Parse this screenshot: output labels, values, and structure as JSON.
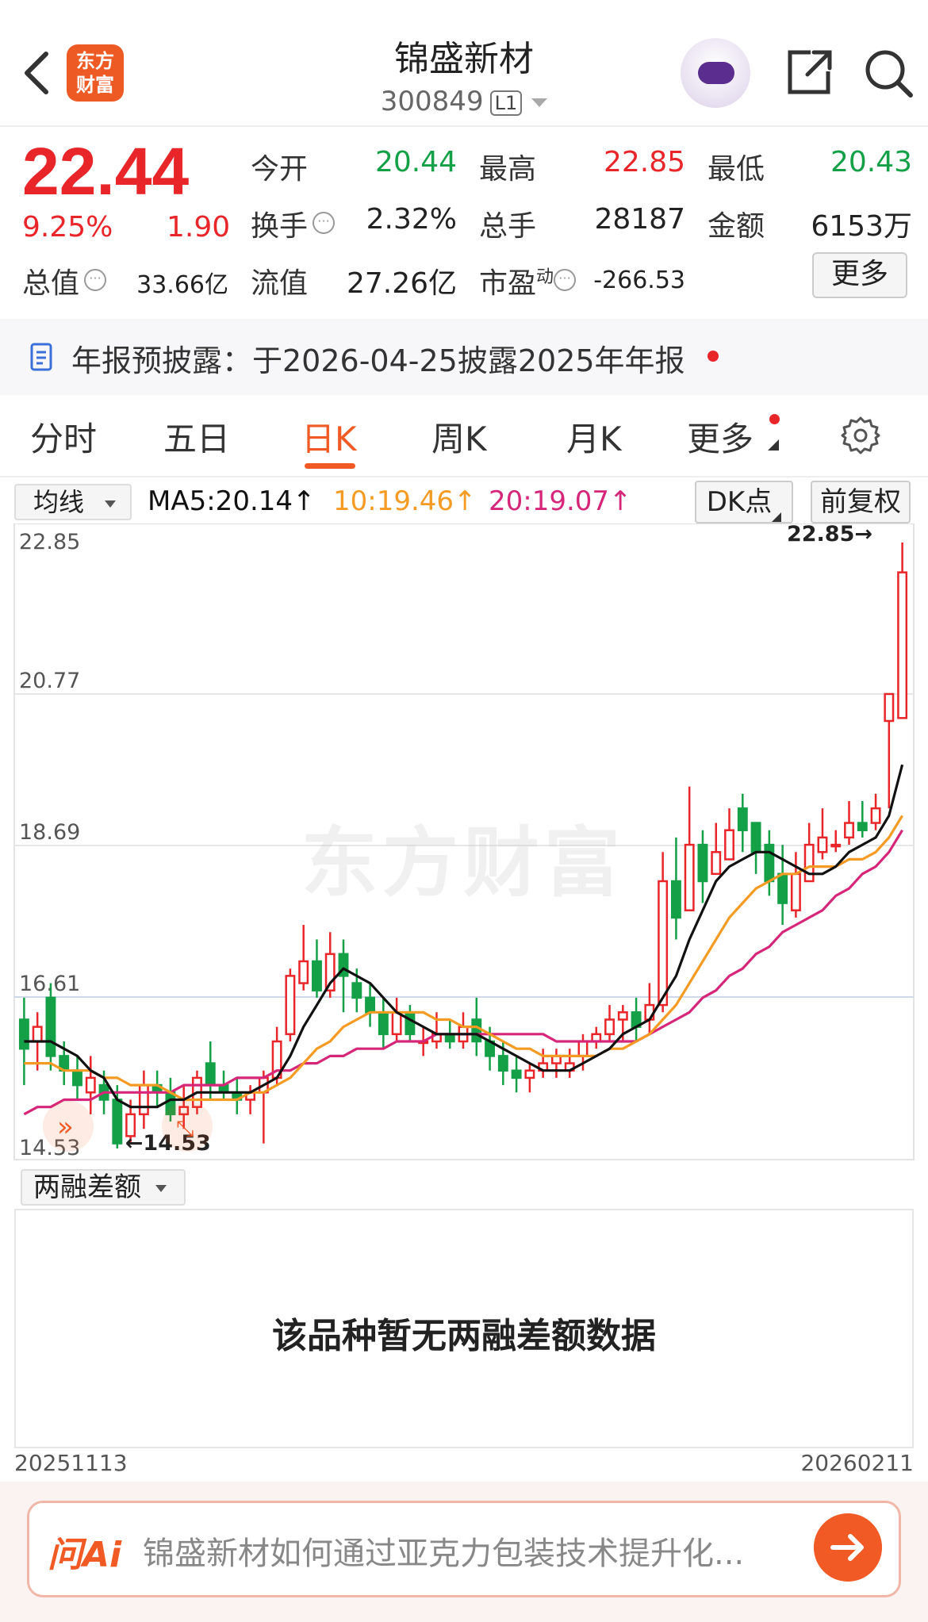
{
  "header": {
    "logo_line1": "东方",
    "logo_line2": "财富",
    "title": "锦盛新材",
    "code": "300849",
    "level_badge": "L1"
  },
  "quote": {
    "price": "22.44",
    "change_pct": "9.25%",
    "change": "1.90",
    "open_label": "今开",
    "open_value": "20.44",
    "high_label": "最高",
    "high_value": "22.85",
    "low_label": "最低",
    "low_value": "20.43",
    "turnover_label": "换手",
    "turnover_value": "2.32%",
    "volume_label": "总手",
    "volume_value": "28187",
    "amount_label": "金额",
    "amount_value": "6153万",
    "mcap_label": "总值",
    "mcap_value": "33.66亿",
    "float_label": "流值",
    "float_value": "27.26亿",
    "pe_label": "市盈",
    "pe_sup": "动",
    "pe_value": "-266.53",
    "more_label": "更多",
    "colors": {
      "up": "#e8262a",
      "down": "#14a046"
    }
  },
  "notice": {
    "text": "年报预披露：于2026-04-25披露2025年年报"
  },
  "tabs": [
    {
      "label": "分时"
    },
    {
      "label": "五日"
    },
    {
      "label": "日K",
      "active": true
    },
    {
      "label": "周K"
    },
    {
      "label": "月K"
    },
    {
      "label": "更多"
    }
  ],
  "indicator": {
    "selector": "均线",
    "ma5": "MA5:20.14↑",
    "ma10": "10:19.46↑",
    "ma20": "20:19.07↑",
    "dk_button": "DK点",
    "adjust_button": "前复权",
    "colors": {
      "ma5": "#111111",
      "ma10": "#f59a23",
      "ma20": "#d6267a"
    }
  },
  "chart_data": {
    "type": "candlestick",
    "y_ticks": [
      "22.85",
      "20.77",
      "18.69",
      "16.61",
      "14.53"
    ],
    "ylim": [
      14.53,
      22.85
    ],
    "max_label": "22.85→",
    "min_label": "←14.53",
    "watermark": "东方财富",
    "candles": [
      [
        16.3,
        15.9,
        16.6,
        15.4
      ],
      [
        16.0,
        16.2,
        16.4,
        15.6
      ],
      [
        16.6,
        15.8,
        16.8,
        15.6
      ],
      [
        15.8,
        15.6,
        16.0,
        15.4
      ],
      [
        15.6,
        15.4,
        15.8,
        15.2
      ],
      [
        15.3,
        15.5,
        15.8,
        15.0
      ],
      [
        15.4,
        15.2,
        15.6,
        15.0
      ],
      [
        15.2,
        14.6,
        15.4,
        14.53
      ],
      [
        14.7,
        15.0,
        15.2,
        14.6
      ],
      [
        15.0,
        15.4,
        15.6,
        14.8
      ],
      [
        15.4,
        15.3,
        15.6,
        15.1
      ],
      [
        15.3,
        15.0,
        15.5,
        14.9
      ],
      [
        15.0,
        15.1,
        15.4,
        14.8
      ],
      [
        15.1,
        15.5,
        15.6,
        15.0
      ],
      [
        15.7,
        15.4,
        16.0,
        15.2
      ],
      [
        15.4,
        15.3,
        15.6,
        15.2
      ],
      [
        15.3,
        15.2,
        15.5,
        15.0
      ],
      [
        15.2,
        15.3,
        15.4,
        15.0
      ],
      [
        15.3,
        15.5,
        15.6,
        14.6
      ],
      [
        15.5,
        16.0,
        16.2,
        15.4
      ],
      [
        16.1,
        16.9,
        17.0,
        16.0
      ],
      [
        16.8,
        17.1,
        17.6,
        16.7
      ],
      [
        17.1,
        16.7,
        17.4,
        16.6
      ],
      [
        16.7,
        17.2,
        17.5,
        16.6
      ],
      [
        17.2,
        16.9,
        17.4,
        16.4
      ],
      [
        16.8,
        16.6,
        17.0,
        16.4
      ],
      [
        16.6,
        16.4,
        16.8,
        16.2
      ],
      [
        16.4,
        16.1,
        16.6,
        15.9
      ],
      [
        16.1,
        16.4,
        16.6,
        16.0
      ],
      [
        16.4,
        16.1,
        16.5,
        16.0
      ],
      [
        16.0,
        16.0,
        16.2,
        15.8
      ],
      [
        16.0,
        16.1,
        16.4,
        15.9
      ],
      [
        16.1,
        16.0,
        16.3,
        15.9
      ],
      [
        16.0,
        16.2,
        16.4,
        15.9
      ],
      [
        16.3,
        16.0,
        16.6,
        15.8
      ],
      [
        16.0,
        15.8,
        16.2,
        15.6
      ],
      [
        15.8,
        15.6,
        16.0,
        15.4
      ],
      [
        15.6,
        15.5,
        15.8,
        15.3
      ],
      [
        15.5,
        15.6,
        15.7,
        15.3
      ],
      [
        15.6,
        15.7,
        15.9,
        15.5
      ],
      [
        15.7,
        15.8,
        15.9,
        15.5
      ],
      [
        15.6,
        15.7,
        15.9,
        15.5
      ],
      [
        15.8,
        16.0,
        16.1,
        15.6
      ],
      [
        16.0,
        16.1,
        16.2,
        15.9
      ],
      [
        16.1,
        16.3,
        16.5,
        16.0
      ],
      [
        16.3,
        16.4,
        16.5,
        16.0
      ],
      [
        16.4,
        16.2,
        16.6,
        16.0
      ],
      [
        16.3,
        16.5,
        16.8,
        16.1
      ],
      [
        16.5,
        18.2,
        18.6,
        16.4
      ],
      [
        18.2,
        17.7,
        18.8,
        17.4
      ],
      [
        17.8,
        18.7,
        19.5,
        17.8
      ],
      [
        18.7,
        18.2,
        18.9,
        17.9
      ],
      [
        18.3,
        18.6,
        19.0,
        18.3
      ],
      [
        18.5,
        18.9,
        19.2,
        18.6
      ],
      [
        19.2,
        18.9,
        19.4,
        18.6
      ],
      [
        19.0,
        18.6,
        19.0,
        18.3
      ],
      [
        18.7,
        18.2,
        18.9,
        18.0
      ],
      [
        18.3,
        17.9,
        18.7,
        17.6
      ],
      [
        17.8,
        18.3,
        18.6,
        17.7
      ],
      [
        18.2,
        18.7,
        19.0,
        18.2
      ],
      [
        18.6,
        18.8,
        19.2,
        18.5
      ],
      [
        18.7,
        18.7,
        18.9,
        18.6
      ],
      [
        18.8,
        19.0,
        19.3,
        18.7
      ],
      [
        19.0,
        18.9,
        19.3,
        18.8
      ],
      [
        19.0,
        19.2,
        19.4,
        18.9
      ],
      [
        20.4,
        20.77,
        20.77,
        19.2
      ],
      [
        20.44,
        22.44,
        22.85,
        20.43
      ]
    ],
    "ma5": [
      16.0,
      16.0,
      16.0,
      15.9,
      15.8,
      15.6,
      15.5,
      15.2,
      15.1,
      15.1,
      15.1,
      15.2,
      15.2,
      15.3,
      15.3,
      15.3,
      15.3,
      15.3,
      15.4,
      15.5,
      15.8,
      16.2,
      16.5,
      16.8,
      17.0,
      16.9,
      16.8,
      16.6,
      16.4,
      16.3,
      16.2,
      16.1,
      16.1,
      16.1,
      16.1,
      16.0,
      15.9,
      15.8,
      15.7,
      15.6,
      15.6,
      15.6,
      15.7,
      15.8,
      15.9,
      16.1,
      16.2,
      16.3,
      16.6,
      16.9,
      17.4,
      17.8,
      18.2,
      18.4,
      18.5,
      18.6,
      18.6,
      18.5,
      18.4,
      18.3,
      18.3,
      18.4,
      18.6,
      18.7,
      18.8,
      19.1,
      19.8
    ],
    "ma10": [
      15.7,
      15.7,
      15.7,
      15.6,
      15.6,
      15.6,
      15.5,
      15.5,
      15.4,
      15.4,
      15.4,
      15.3,
      15.2,
      15.2,
      15.2,
      15.2,
      15.2,
      15.3,
      15.3,
      15.4,
      15.5,
      15.7,
      15.9,
      16.0,
      16.2,
      16.3,
      16.4,
      16.4,
      16.4,
      16.4,
      16.4,
      16.3,
      16.3,
      16.2,
      16.2,
      16.1,
      16.0,
      15.9,
      15.9,
      15.8,
      15.8,
      15.8,
      15.8,
      15.8,
      15.9,
      15.9,
      16.0,
      16.1,
      16.3,
      16.5,
      16.8,
      17.1,
      17.4,
      17.7,
      17.9,
      18.1,
      18.2,
      18.3,
      18.3,
      18.4,
      18.4,
      18.4,
      18.5,
      18.5,
      18.6,
      18.8,
      19.1
    ],
    "ma20": [
      15.0,
      15.1,
      15.1,
      15.2,
      15.2,
      15.2,
      15.3,
      15.3,
      15.3,
      15.3,
      15.3,
      15.3,
      15.4,
      15.4,
      15.4,
      15.4,
      15.5,
      15.5,
      15.5,
      15.6,
      15.6,
      15.7,
      15.7,
      15.8,
      15.8,
      15.9,
      15.9,
      15.9,
      16.0,
      16.0,
      16.0,
      16.1,
      16.1,
      16.1,
      16.1,
      16.1,
      16.1,
      16.1,
      16.1,
      16.1,
      16.0,
      16.0,
      16.0,
      16.0,
      16.0,
      16.0,
      16.0,
      16.1,
      16.2,
      16.3,
      16.4,
      16.6,
      16.7,
      16.9,
      17.0,
      17.2,
      17.3,
      17.5,
      17.6,
      17.7,
      17.8,
      18.0,
      18.1,
      18.3,
      18.4,
      18.6,
      18.9
    ]
  },
  "margin_panel": {
    "selector": "两融差额",
    "empty_text": "该品种暂无两融差额数据",
    "date_start": "20251113",
    "date_end": "20260211"
  },
  "ai": {
    "logo": "问Ai",
    "placeholder": "锦盛新材如何通过亚克力包装技术提升化..."
  }
}
